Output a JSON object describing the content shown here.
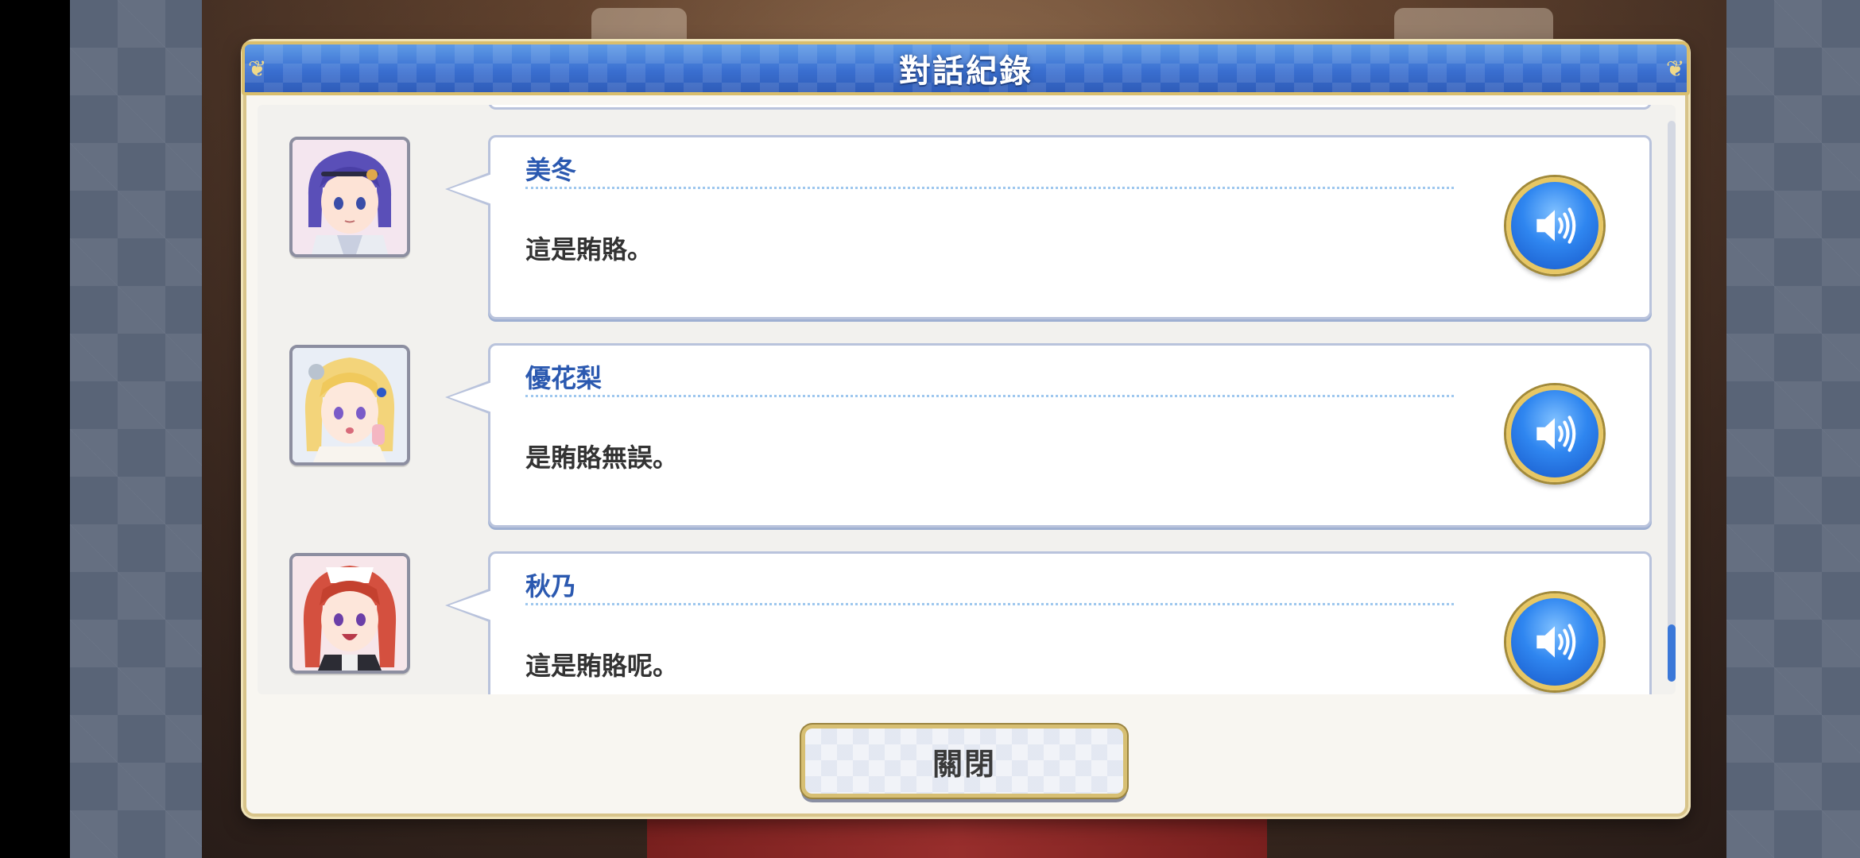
{
  "dialog": {
    "title": "對話紀錄",
    "close_label": "關閉"
  },
  "log": {
    "entries": [
      {
        "speaker": "美冬",
        "text": "這是賄賂。",
        "avatar": "character-portrait-purple-hair",
        "voice_icon": "speaker-icon"
      },
      {
        "speaker": "優花梨",
        "text": "是賄賂無誤。",
        "avatar": "character-portrait-blonde-hair",
        "voice_icon": "speaker-icon"
      },
      {
        "speaker": "秋乃",
        "text": "這是賄賂呢。",
        "avatar": "character-portrait-red-hair",
        "voice_icon": "speaker-icon"
      }
    ]
  },
  "colors": {
    "title_bar": "#3a6fd0",
    "gold_border": "#d8c48a",
    "speaker_name": "#2b59b0",
    "voice_button": "#2f86f0",
    "scroll_thumb": "#3b78d8"
  }
}
